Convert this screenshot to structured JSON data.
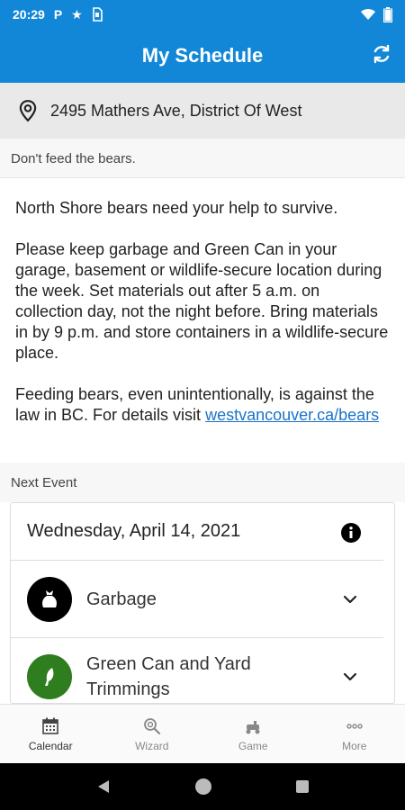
{
  "status_bar": {
    "time": "20:29",
    "icons": [
      "parking-icon",
      "star-icon",
      "sd-card-icon"
    ],
    "right_icons": [
      "wifi-icon",
      "battery-icon"
    ]
  },
  "app_bar": {
    "title": "My Schedule",
    "action_icon": "refresh-icon"
  },
  "address": {
    "icon": "location-pin-icon",
    "text": "2495 Mathers Ave, District Of West"
  },
  "notice": {
    "heading": "Don't feed the bears.",
    "paragraphs": [
      "North Shore bears need your help to survive.",
      "Please keep garbage and Green Can in your garage, basement or wildlife-secure location during the week. Set materials out after 5 a.m. on collection day, not the night before. Bring materials in by 9 p.m. and store containers in a wildlife-secure place.",
      "Feeding bears, even unintentionally, is against the law in BC. For details visit"
    ],
    "link": "westvancouver.ca/bears"
  },
  "next_event": {
    "label": "Next Event",
    "date": "Wednesday, April 14, 2021",
    "info_icon": "info-icon",
    "items": [
      {
        "label": "Garbage",
        "icon": "garbage-bag-icon",
        "color": "#000000"
      },
      {
        "label": "Green Can and Yard Trimmings",
        "icon": "leaf-icon",
        "color": "#2e7d1e"
      }
    ]
  },
  "bottom_nav": {
    "items": [
      {
        "label": "Calendar",
        "icon": "calendar-icon",
        "active": true
      },
      {
        "label": "Wizard",
        "icon": "search-icon",
        "active": false
      },
      {
        "label": "Game",
        "icon": "game-icon",
        "active": false
      },
      {
        "label": "More",
        "icon": "more-icon",
        "active": false
      }
    ]
  },
  "colors": {
    "brand": "#1287d8",
    "link": "#1a73c8"
  }
}
